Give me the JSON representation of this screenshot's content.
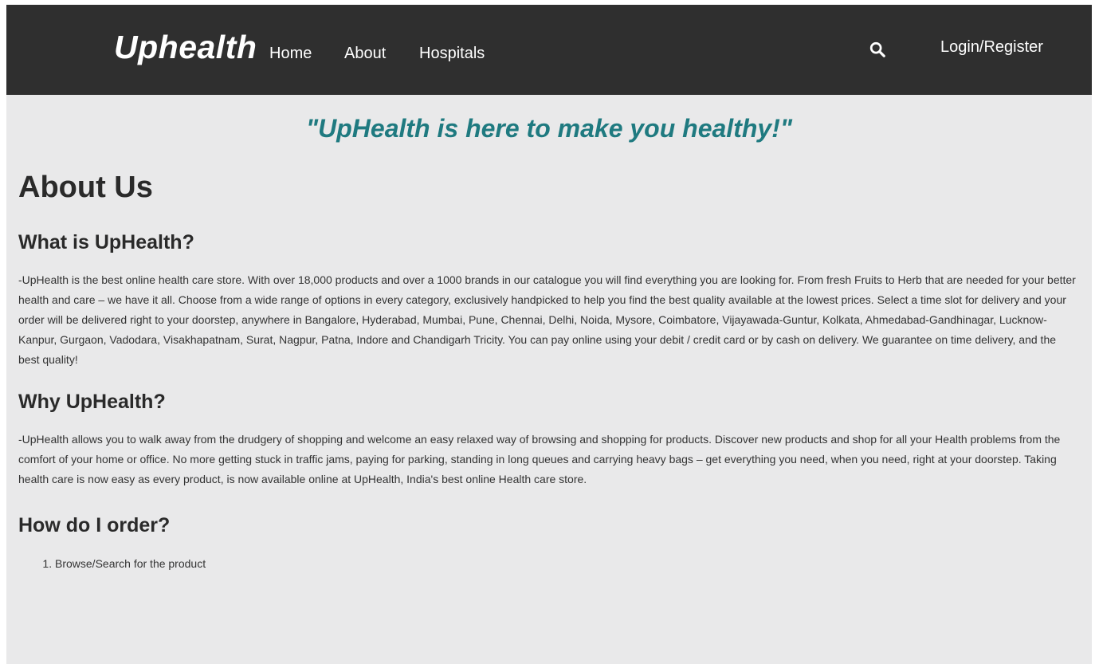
{
  "nav": {
    "brand": "Uphealth",
    "links": [
      "Home",
      "About",
      "Hospitals"
    ],
    "search_icon": "search-icon",
    "login": "Login/Register"
  },
  "tagline": "\"UpHealth is here to make you healthy!\"",
  "about": {
    "title": "About Us",
    "what_heading": "What is UpHealth?",
    "what_text": "-UpHealth is the best online health care store. With over 18,000 products and over a 1000 brands in our catalogue you will find everything you are looking for. From fresh Fruits to Herb that are needed for your better health and care – we have it all. Choose from a wide range of options in every category, exclusively handpicked to help you find the best quality available at the lowest prices. Select a time slot for delivery and your order will be delivered right to your doorstep, anywhere in Bangalore, Hyderabad, Mumbai, Pune, Chennai, Delhi, Noida, Mysore, Coimbatore, Vijayawada-Guntur, Kolkata, Ahmedabad-Gandhinagar, Lucknow-Kanpur, Gurgaon, Vadodara, Visakhapatnam, Surat, Nagpur, Patna, Indore and Chandigarh Tricity. You can pay online using your debit / credit card or by cash on delivery. We guarantee on time delivery, and the best quality!",
    "why_heading": "Why UpHealth?",
    "why_text": "-UpHealth allows you to walk away from the drudgery of shopping and welcome an easy relaxed way of browsing and shopping for products. Discover new products and shop for all your Health problems from the comfort of your home or office. No more getting stuck in traffic jams, paying for parking, standing in long queues and carrying heavy bags – get everything you need, when you need, right at your doorstep. Taking health care is now easy as every product, is now available online at UpHealth, India's best online Health care store.",
    "how_heading": "How do I order?",
    "steps": [
      "Browse/Search for the product"
    ]
  },
  "colors": {
    "navbar": "#2f2f2f",
    "background": "#e9e9ea",
    "tagline": "#1f7a80"
  }
}
